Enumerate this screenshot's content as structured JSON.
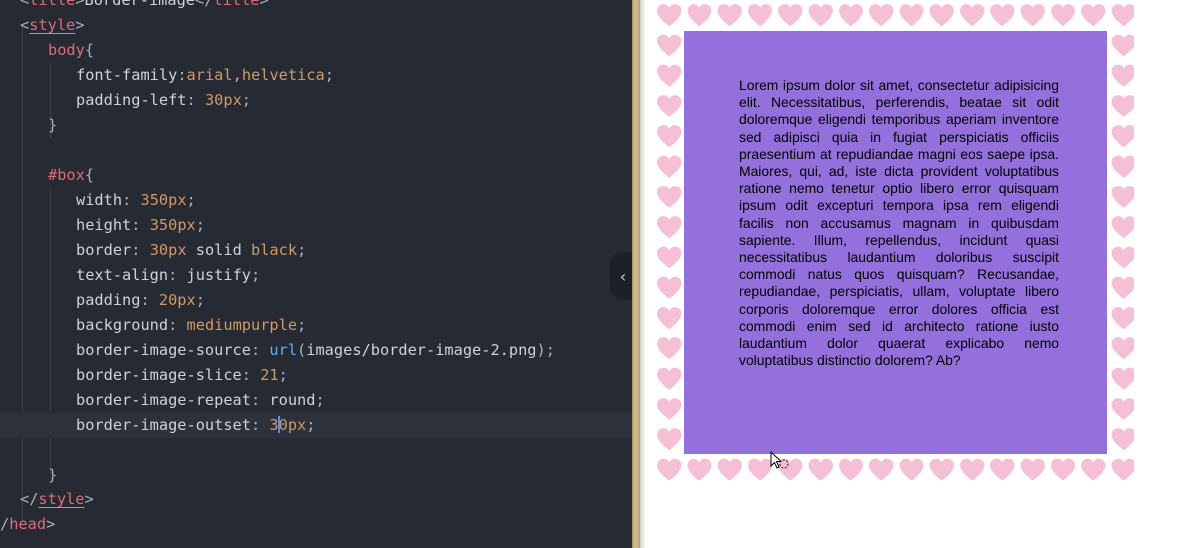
{
  "editor": {
    "lines": [
      {
        "tokens": [
          {
            "t": "<",
            "c": "tok-punct"
          },
          {
            "t": "title",
            "c": "tok-tag"
          },
          {
            "t": ">",
            "c": "tok-punct"
          },
          {
            "t": "Border-image",
            "c": "tok-prop"
          },
          {
            "t": "</",
            "c": "tok-punct"
          },
          {
            "t": "title",
            "c": "tok-tag"
          },
          {
            "t": ">",
            "c": "tok-punct"
          }
        ]
      },
      {
        "tokens": [
          {
            "t": "<",
            "c": "tok-punct"
          },
          {
            "t": "style",
            "c": "tok-tag-ul"
          },
          {
            "t": ">",
            "c": "tok-punct"
          }
        ]
      },
      {
        "tokens": [
          {
            "t": "body",
            "c": "tok-sel"
          },
          {
            "t": "{",
            "c": "tok-punct"
          }
        ]
      },
      {
        "tokens": [
          {
            "t": "font-family",
            "c": "tok-prop"
          },
          {
            "t": ":",
            "c": "tok-punct"
          },
          {
            "t": "arial",
            "c": "tok-val"
          },
          {
            "t": ",",
            "c": "tok-punct"
          },
          {
            "t": "helvetica",
            "c": "tok-val"
          },
          {
            "t": ";",
            "c": "tok-punct"
          }
        ]
      },
      {
        "tokens": [
          {
            "t": "padding-left",
            "c": "tok-prop"
          },
          {
            "t": ": ",
            "c": "tok-punct"
          },
          {
            "t": "30px",
            "c": "tok-num"
          },
          {
            "t": ";",
            "c": "tok-punct"
          }
        ]
      },
      {
        "tokens": [
          {
            "t": "}",
            "c": "tok-punct"
          }
        ]
      },
      {
        "tokens": []
      },
      {
        "tokens": [
          {
            "t": "#box",
            "c": "tok-sel"
          },
          {
            "t": "{",
            "c": "tok-punct"
          }
        ]
      },
      {
        "tokens": [
          {
            "t": "width",
            "c": "tok-prop"
          },
          {
            "t": ": ",
            "c": "tok-punct"
          },
          {
            "t": "350px",
            "c": "tok-num"
          },
          {
            "t": ";",
            "c": "tok-punct"
          }
        ]
      },
      {
        "tokens": [
          {
            "t": "height",
            "c": "tok-prop"
          },
          {
            "t": ": ",
            "c": "tok-punct"
          },
          {
            "t": "350px",
            "c": "tok-num"
          },
          {
            "t": ";",
            "c": "tok-punct"
          }
        ]
      },
      {
        "tokens": [
          {
            "t": "border",
            "c": "tok-prop"
          },
          {
            "t": ": ",
            "c": "tok-punct"
          },
          {
            "t": "30px",
            "c": "tok-num"
          },
          {
            "t": " solid ",
            "c": "tok-prop"
          },
          {
            "t": "black",
            "c": "tok-val"
          },
          {
            "t": ";",
            "c": "tok-punct"
          }
        ]
      },
      {
        "tokens": [
          {
            "t": "text-align",
            "c": "tok-prop"
          },
          {
            "t": ": ",
            "c": "tok-punct"
          },
          {
            "t": "justify",
            "c": "tok-prop"
          },
          {
            "t": ";",
            "c": "tok-punct"
          }
        ]
      },
      {
        "tokens": [
          {
            "t": "padding",
            "c": "tok-prop"
          },
          {
            "t": ": ",
            "c": "tok-punct"
          },
          {
            "t": "20px",
            "c": "tok-num"
          },
          {
            "t": ";",
            "c": "tok-punct"
          }
        ]
      },
      {
        "tokens": [
          {
            "t": "background",
            "c": "tok-prop"
          },
          {
            "t": ": ",
            "c": "tok-punct"
          },
          {
            "t": "mediumpurple",
            "c": "tok-val"
          },
          {
            "t": ";",
            "c": "tok-punct"
          }
        ]
      },
      {
        "tokens": [
          {
            "t": "border-image-source",
            "c": "tok-prop"
          },
          {
            "t": ": ",
            "c": "tok-punct"
          },
          {
            "t": "url",
            "c": "tok-fn"
          },
          {
            "t": "(",
            "c": "tok-punct"
          },
          {
            "t": "images/border-image-2.png",
            "c": "tok-str"
          },
          {
            "t": ");",
            "c": "tok-punct"
          }
        ]
      },
      {
        "tokens": [
          {
            "t": "border-image-slice",
            "c": "tok-prop"
          },
          {
            "t": ": ",
            "c": "tok-punct"
          },
          {
            "t": "21",
            "c": "tok-num"
          },
          {
            "t": ";",
            "c": "tok-punct"
          }
        ]
      },
      {
        "tokens": [
          {
            "t": "border-image-repeat",
            "c": "tok-prop"
          },
          {
            "t": ": ",
            "c": "tok-punct"
          },
          {
            "t": "round",
            "c": "tok-prop"
          },
          {
            "t": ";",
            "c": "tok-punct"
          }
        ]
      },
      {
        "tokens": [
          {
            "t": "border-image-outset",
            "c": "tok-prop"
          },
          {
            "t": ": ",
            "c": "tok-punct"
          },
          {
            "t": "3",
            "c": "tok-num"
          },
          {
            "t": "|",
            "c": "caret"
          },
          {
            "t": "0px",
            "c": "tok-num"
          },
          {
            "t": ";",
            "c": "tok-punct"
          }
        ]
      },
      {
        "tokens": []
      },
      {
        "tokens": []
      },
      {
        "tokens": [
          {
            "t": "}",
            "c": "tok-punct"
          }
        ]
      },
      {
        "tokens": [
          {
            "t": "</",
            "c": "tok-punct"
          },
          {
            "t": "style",
            "c": "tok-tag-ul"
          },
          {
            "t": ">",
            "c": "tok-punct"
          }
        ]
      },
      {
        "tokens": [
          {
            "t": "/",
            "c": "tok-punct"
          },
          {
            "t": "head",
            "c": "tok-tag"
          },
          {
            "t": ">",
            "c": "tok-punct"
          }
        ]
      }
    ],
    "collapse_icon": "chevron-left-icon",
    "collapse_glyph": "‹"
  },
  "preview": {
    "box_text": "Lorem ipsum dolor sit amet, consectetur adipisicing elit. Necessitatibus, perferendis, beatae sit odit doloremque eligendi temporibus aperiam inventore sed adipisci quia in fugiat perspiciatis officiis praesentium at repudiandae magni eos saepe ipsa. Maiores, qui, ad, iste dicta provident voluptatibus ratione nemo tenetur optio libero error quisquam ipsum odit excepturi tempora ipsa rem eligendi facilis non accusamus magnam in quibusdam sapiente. Illum, repellendus, incidunt quasi necessitatibus laudantium doloribus suscipit commodi natus quos quisquam? Recusandae, repudiandae, perspiciatis, ullam, voluptate libero corporis doloremque error dolores officia est commodi enim sed id architecto ratione iusto laudantium dolor quaerat explicabo nemo voluptatibus distinctio dolorem? Ab?",
    "box_background": "#9370db",
    "border_heart_color": "#f5bfd5",
    "cursor_icon": "busy-pointer-icon"
  }
}
